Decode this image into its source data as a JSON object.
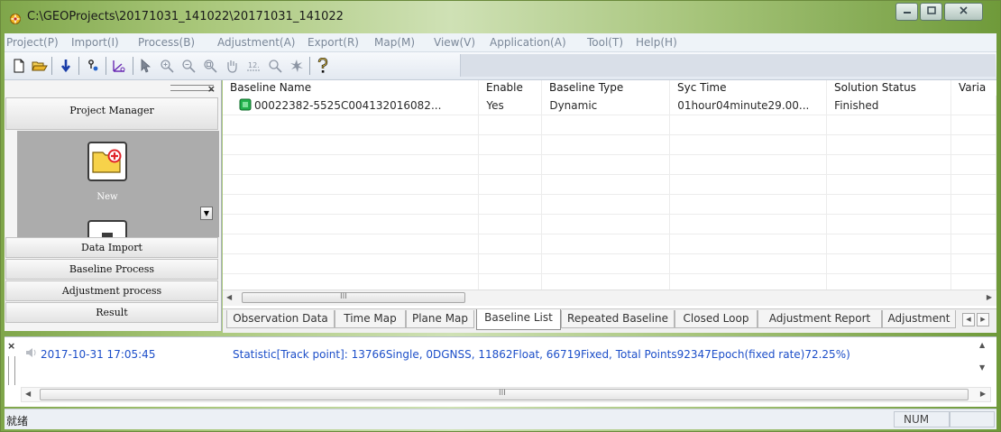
{
  "window": {
    "title": "C:\\GEOProjects\\20171031_141022\\20171031_141022",
    "minimize_icon": "minimize-icon",
    "maximize_icon": "maximize-icon",
    "close_icon": "close-icon"
  },
  "menubar": {
    "items": [
      {
        "label": "Project(P)"
      },
      {
        "label": "Import(I)"
      },
      {
        "label": "Process(B)"
      },
      {
        "label": "Adjustment(A)"
      },
      {
        "label": "Export(R)"
      },
      {
        "label": "Map(M)"
      },
      {
        "label": "View(V)"
      },
      {
        "label": "Application(A)"
      },
      {
        "label": "Tool(T)"
      },
      {
        "label": "Help(H)"
      }
    ]
  },
  "toolbar": {
    "icons": [
      "new-document-icon",
      "open-folder-icon",
      "import-arrow-icon",
      "process-icon",
      "adjustment-icon",
      "select-pointer-icon",
      "zoom-in-icon",
      "zoom-out-icon",
      "zoom-extent-icon",
      "pan-hand-icon",
      "measure-icon",
      "zoom-window-icon",
      "refresh-icon",
      "help-icon"
    ]
  },
  "left_panel": {
    "close_label": "×",
    "header": "Project Manager",
    "new_label": "New",
    "sections": [
      {
        "label": "Data Import"
      },
      {
        "label": "Baseline Process"
      },
      {
        "label": "Adjustment process"
      },
      {
        "label": "Result"
      }
    ]
  },
  "baseline_table": {
    "columns": [
      "Baseline Name",
      "Enable",
      "Baseline Type",
      "Syc Time",
      "Solution Status",
      "Varia"
    ],
    "rows": [
      {
        "name": "00022382-5525C004132016082...",
        "enable": "Yes",
        "type": "Dynamic",
        "syc_time": "01hour04minute29.00...",
        "status": "Finished",
        "variance": ""
      }
    ],
    "scroll_label": "III"
  },
  "tabs": {
    "items": [
      {
        "label": "Observation Data"
      },
      {
        "label": "Time Map"
      },
      {
        "label": "Plane Map"
      },
      {
        "label": "Baseline List",
        "active": true
      },
      {
        "label": "Repeated Baseline"
      },
      {
        "label": "Closed Loop"
      },
      {
        "label": "Adjustment Report"
      },
      {
        "label": "Adjustment"
      }
    ]
  },
  "output": {
    "close_label": "×",
    "timestamp": "2017-10-31 17:05:45",
    "message": "Statistic[Track point]: 13766Single, 0DGNSS, 11862Float, 66719Fixed, Total Points92347Epoch(fixed rate)72.25%)",
    "scroll_label": "III"
  },
  "statusbar": {
    "text": "就绪",
    "num": "NUM"
  },
  "colors": {
    "accent_link": "#1d4fc9",
    "folder_yellow": "#f7d24a",
    "plus_red": "#e0242a",
    "status_green": "#22b14c"
  }
}
